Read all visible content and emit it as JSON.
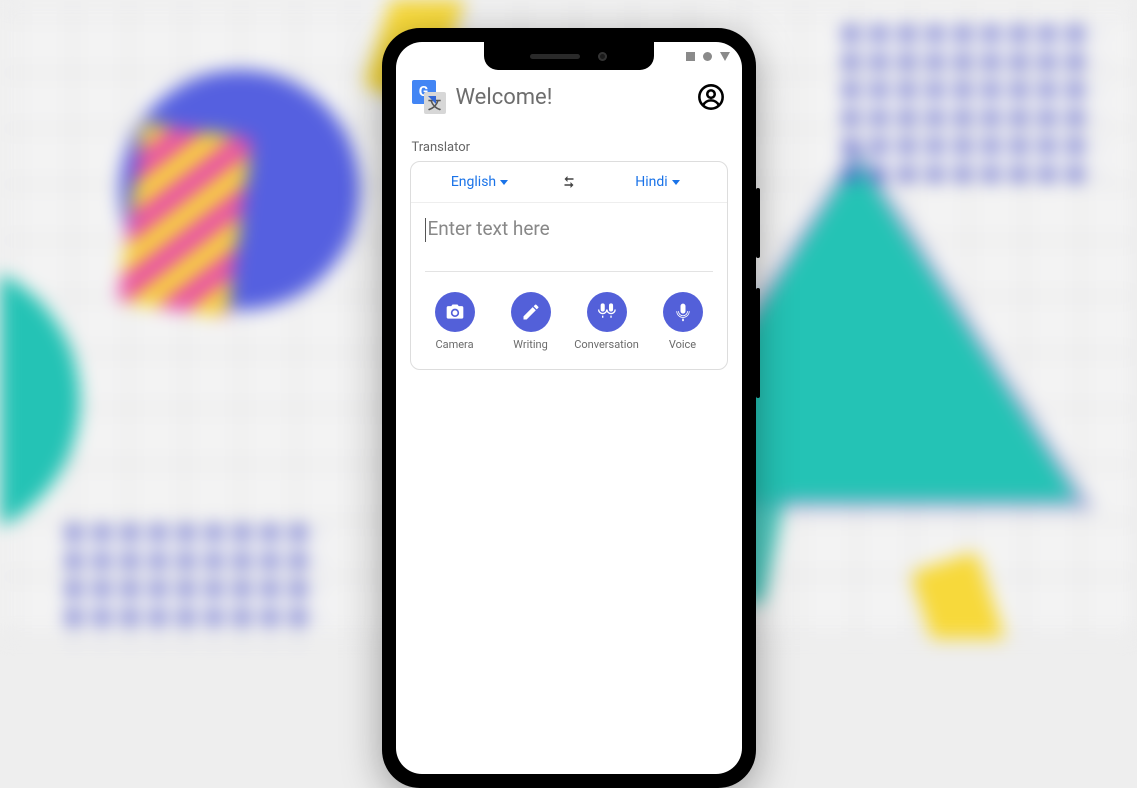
{
  "header": {
    "title": "Welcome!",
    "logo_letter_primary": "G",
    "logo_letter_secondary": "文"
  },
  "section_label": "Translator",
  "languages": {
    "source": "English",
    "target": "Hindi"
  },
  "input": {
    "placeholder": "Enter text here"
  },
  "modes": {
    "camera": "Camera",
    "writing": "Writing",
    "conversation": "Conversation",
    "voice": "Voice"
  },
  "colors": {
    "accent": "#1a73e8",
    "mode_bubble": "#5360d9"
  }
}
